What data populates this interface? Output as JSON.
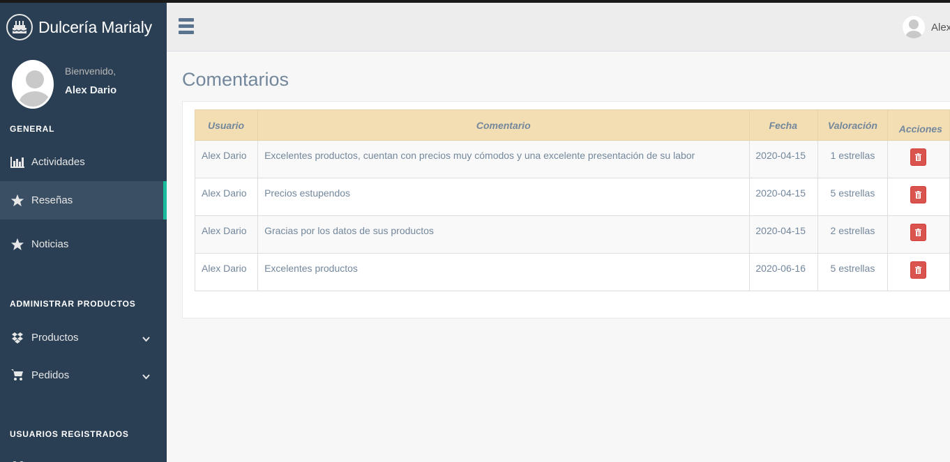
{
  "app": {
    "brand": "Dulcería Marialy",
    "brand_icon": "cake-icon"
  },
  "profile": {
    "welcome": "Bienvenido,",
    "name": "Alex Dario"
  },
  "sidebar": {
    "sections": [
      {
        "title": "GENERAL",
        "items": [
          {
            "label": "Actividades",
            "icon": "bar-chart-icon",
            "active": false
          },
          {
            "label": "Reseñas",
            "icon": "star-icon",
            "active": true
          },
          {
            "label": "Noticias",
            "icon": "star-icon",
            "active": false
          }
        ]
      },
      {
        "title": "ADMINISTRAR PRODUCTOS",
        "items": [
          {
            "label": "Productos",
            "icon": "dropbox-icon",
            "expandable": true
          },
          {
            "label": "Pedidos",
            "icon": "shopping-cart-icon",
            "expandable": true
          }
        ]
      },
      {
        "title": "USUARIOS REGISTRADOS",
        "items": []
      }
    ]
  },
  "topnav": {
    "menu_icon": "hamburger-icon",
    "user_name": "Alex"
  },
  "page": {
    "title": "Comentarios"
  },
  "table": {
    "headers": [
      "Usuario",
      "Comentario",
      "Fecha",
      "Valoración",
      "Acciones"
    ],
    "rows": [
      {
        "usuario": "Alex Dario",
        "comentario": "Excelentes productos, cuentan con precios muy cómodos y una excelente presentación de su labor",
        "fecha": "2020-04-15",
        "valoracion": "1 estrellas"
      },
      {
        "usuario": "Alex Dario",
        "comentario": "Precios estupendos",
        "fecha": "2020-04-15",
        "valoracion": "5 estrellas"
      },
      {
        "usuario": "Alex Dario",
        "comentario": "Gracias por los datos de sus productos",
        "fecha": "2020-04-15",
        "valoracion": "2 estrellas"
      },
      {
        "usuario": "Alex Dario",
        "comentario": "Excelentes productos",
        "fecha": "2020-06-16",
        "valoracion": "5 estrellas"
      }
    ],
    "delete_icon": "trash-icon"
  },
  "colors": {
    "sidebar_bg": "#2a3f54",
    "active_indicator": "#1abb9c",
    "table_header_bg": "#f3deb4",
    "delete_button": "#d9534f"
  }
}
